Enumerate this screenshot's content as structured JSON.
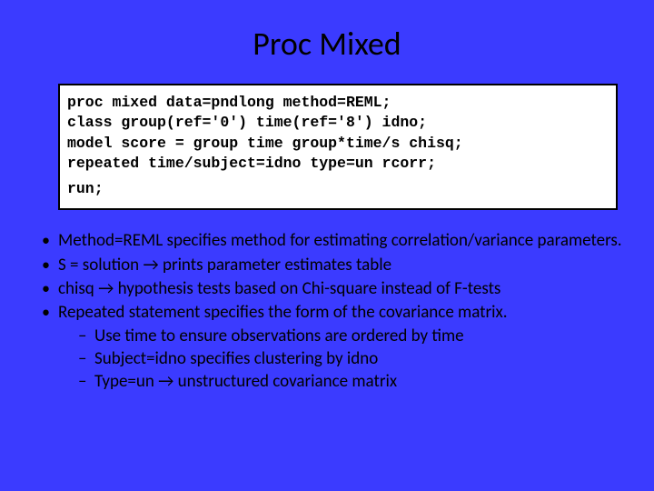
{
  "title": "Proc Mixed",
  "code": {
    "l1": "proc mixed data=pndlong method=REML;",
    "l2": "class group(ref='0') time(ref='8') idno;",
    "l3": "model score = group time group*time/s chisq;",
    "l4": "repeated time/subject=idno type=un rcorr;",
    "l5": "run;"
  },
  "arrow": "→",
  "bullets": {
    "b1": "Method=REML specifies method for estimating correlation/variance parameters.",
    "b2a": "S = solution ",
    "b2b": " prints parameter estimates table",
    "b3a": "chisq ",
    "b3b": " hypothesis tests based on Chi-square instead of F-tests",
    "b4": "Repeated statement specifies the form of the covariance matrix.",
    "s1": "Use time to ensure observations are ordered by time",
    "s2": "Subject=idno specifies clustering by idno",
    "s3a": "Type=un ",
    "s3b": " unstructured covariance matrix"
  }
}
